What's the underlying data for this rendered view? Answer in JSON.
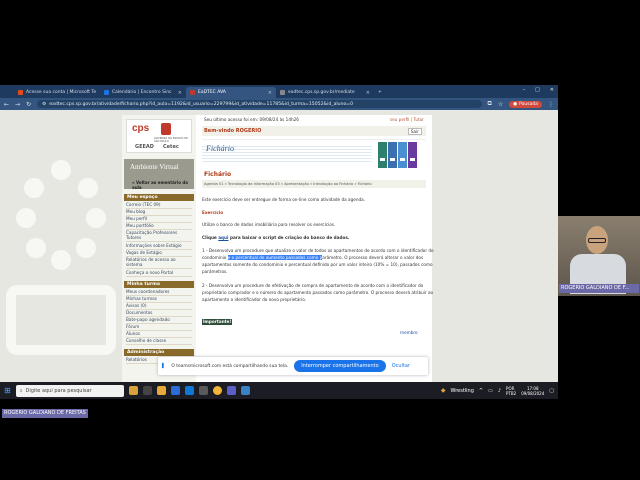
{
  "browser": {
    "tabs": [
      {
        "label": "Acesse sua conta | Microsoft Te",
        "icon": "microsoft-icon",
        "color": "#e64a19"
      },
      {
        "label": "Calendário | Encontro Sinc",
        "icon": "calendar-icon",
        "color": "#1a73e8"
      },
      {
        "label": "EaDTEC AVA",
        "icon": "ava-icon",
        "color": "#c0392b",
        "active": true
      },
      {
        "label": "eadtec.cps.sp.gov.br/mediate",
        "icon": "page-icon",
        "color": "#888888"
      }
    ],
    "new_tab": "+",
    "url": "eadtec.cps.sp.gov.br/atividade/fichario.php?id_aula=1192&id_usuario=229799&id_atividade=11785&id_turma=15052&id_aluno=0",
    "pause_label": "Pausada"
  },
  "site": {
    "last_access": "Seu último acesso foi em: 09/08/24 às 14h26",
    "profile_link": "seu perfil | Tutor",
    "welcome": "Bem-vindo ROGERIO",
    "exit_label": "Sair",
    "logo_cps": "cps",
    "logo_gov": "GOVERNO DO ESTADO DE SÃO PAULO",
    "logo_geead": "GEEAD",
    "logo_cetec": "Cetec",
    "ambiente_label": "Ambiente Virtual",
    "ambiente_back": "Voltar ao ementário da aula",
    "banner_text": "Fichário",
    "menu_meu_espaco": "Meu espaço",
    "menu_meu_espaco_items": [
      "Correio (TEC 09)",
      "Meu blog",
      "Meu perfil",
      "Meu portfólio",
      "Capacitação Professores Tutores",
      "Informações sobre Estágio",
      "Vagas de Estágio",
      "Relatórios de acesso ao sistema",
      "Conheça o novo Portal"
    ],
    "menu_minha_turma": "Minha turma",
    "menu_minha_turma_items": [
      "Meus coordenadores",
      "Minhas turmas",
      "Avisos (0)",
      "Documentos",
      "Bate-papo agendado",
      "Fórum",
      "Alunos",
      "Conselho de classe"
    ],
    "menu_admin": "Administração",
    "menu_admin_items": [
      "Relatórios"
    ],
    "page_title": "Fichário",
    "breadcrumb": "Agenda 01 » Tecnologia da Informação 03 » Apresentação » Introdução ao Fichário » Fichário",
    "intro": "Este exercício deve ser entregue de forma on-line como atividade da agenda.",
    "section_exercise": "Exercício",
    "use_db": "Utilize o banco de dados imobiliária para resolver os exercícios.",
    "click_prefix": "Clique ",
    "click_link": "aqui",
    "click_suffix": " para baixar o script de criação do banco de dados.",
    "p1_a": "1 - Desenvolva um procedure que atualize o valor de todos os apartamentos de acordo com o identificador do",
    "p1_b_pre": "condomínio ",
    "p1_b_hl": "e o percentual de aumento passados como p",
    "p1_b_post": "arâmetro. O processo deverá alterar o valor dos",
    "p1_c": "apartamentos somente do condomínio e percentual definido por um valor inteiro (10% = 10), passados como",
    "p1_d": "parâmetros.",
    "p2_a": "2 - Desenvolva um procedure de efetivação de compra de apartamento de acordo com o identificador do",
    "p2_b": "proprietário comprador e o número do apartamento passados como parâmetro. O processo deverá atribuir ao",
    "p2_c": "apartamento o identificador do novo proprietário.",
    "important": "Importante!",
    "membro": "membro"
  },
  "share": {
    "message": "O teamsmicrosoft.com está compartilhando sua tela.",
    "stop": "Interromper compartilhamento",
    "hide": "Ocultar"
  },
  "taskbar": {
    "search_placeholder": "Digite aqui para pesquisar",
    "now_playing": "Wrestling",
    "lang": "POR",
    "lang2": "PTB2",
    "time": "17:08",
    "date": "09/08/2024"
  },
  "video": {
    "participant_name": "ROGERIO GALDIANO DE F...",
    "self_name": "ROGERIO GALDIANO DE FREITAS"
  }
}
